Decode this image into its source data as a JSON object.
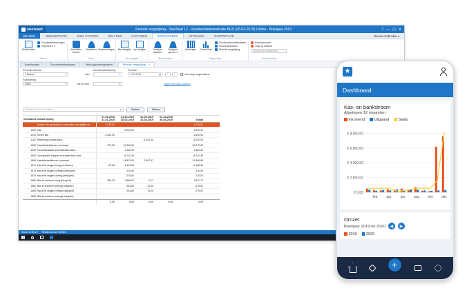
{
  "window": {
    "app_name": "snelstart",
    "title": "Periode vergelijking - SnelStart 12 - Voorbeeldadministratie BGS (05-02-2019) Online - Boekjaar 2019",
    "controls": [
      "?",
      "—",
      "▢",
      "✕"
    ]
  },
  "menu_tabs": [
    "BEHEER",
    "ADMINISTRATIE",
    "SNEL STARTEN",
    "RELATIES",
    "FACTUREN",
    "BOEKHOUDEN",
    "ARTIKELEN",
    "RAPPORTAGE"
  ],
  "active_menu_tab": "BOEKHOUDEN",
  "user_label": "Nieuwe Gebruiker ▾",
  "ribbon": {
    "groups": [
      {
        "label": "Beheer",
        "items": [
          {
            "label": "Boekhouden",
            "icon": "ledger-icon"
          }
        ],
        "small": [
          "Grootboekrekeningen",
          "Importeren ▾"
        ]
      },
      {
        "label": "Bank",
        "items": [
          {
            "label": "Afschriften inlezen",
            "icon": "download-icon"
          },
          {
            "label": "Bankieren",
            "icon": "bank-icon"
          },
          {
            "label": "Bankboekingen",
            "icon": "bank-book-icon"
          }
        ]
      },
      {
        "label": "Btw-aangifte",
        "items": [
          {
            "label": "Btw-aangifte",
            "icon": "vat-icon"
          },
          {
            "label": "Icp-aangifte",
            "icon": "icp-icon"
          }
        ]
      },
      {
        "label": "Afschrijvingen",
        "items": [
          {
            "label": "Boekjaar afsluiten",
            "icon": "close-year-icon"
          },
          {
            "label": "Boekjaar openen ▾",
            "icon": "open-year-icon"
          }
        ]
      },
      {
        "label": "Rapportage",
        "items": [
          {
            "label": "Boekingen",
            "icon": "bookings-icon"
          },
          {
            "label": "Overzichten",
            "icon": "reports-icon"
          }
        ],
        "small": [
          "Grootboekmutatiekaarten",
          "Kolommenbalans",
          "Periode vergelijking"
        ]
      },
      {
        "label": "Ondersteuning",
        "small": [
          "Klantenservice",
          "Hulp op afstand"
        ],
        "search_placeholder": "Zoeken op kenmerk/fun..."
      }
    ]
  },
  "doc_tabs": [
    "Boekhouden",
    "Grootboekrekeningen",
    "Verkoopjournaalposten",
    "Periode vergelijking"
  ],
  "active_doc_tab": "Periode vergelijking",
  "filters": {
    "periode_selectie_label": "Periode selectie",
    "periode_selectie_value": "4 Maand",
    "rubricering_label": "Rubricering",
    "rubricering_value": "Geen",
    "grootboekrekening_label": "Grootboekrekening",
    "van_label": "Van",
    "tot_label": "Tot en met",
    "periode_label": "Periode",
    "periode_value": "1-01-2019",
    "voorloop_label": "Voorloop beginbalans",
    "link_label": "Open het oude scherm",
    "search_placeholder": "Vind tekst in een te zoeken...",
    "zoeken_label": "Zoeken",
    "wissen_label": "Wissen"
  },
  "table": {
    "headers": {
      "nr": "Grootboek",
      "omschrijving": "Omschrijving",
      "periods": [
        {
          "from": "01-01-2019",
          "to": "31-01-2019"
        },
        {
          "from": "01-02-2019",
          "to": "28-02-2019"
        },
        {
          "from": "01-03-2019",
          "to": "31-03-2019"
        },
        {
          "from": "01-04-2019",
          "to": "30-04-2019"
        }
      ],
      "totaal": "Totaal"
    },
    "rows": [
      {
        "nr": "",
        "omschrijving": "Kosten van opstelling en aanvullen van afgifte en...",
        "p1": "1.276,67",
        "p2": "",
        "p3": "",
        "p4": "",
        "totaal": "1.276,67",
        "highlight": true
      },
      {
        "nr": "1000",
        "omschrijving": "Kas",
        "p1": "",
        "p2": "3.210,00",
        "p3": "",
        "p4": "",
        "totaal": "3.210,00"
      },
      {
        "nr": "1010",
        "omschrijving": "Kleine kas",
        "p1": "-1.500,00",
        "p2": "",
        "p3": "",
        "p4": "",
        "totaal": "-1.500,00"
      },
      {
        "nr": "1100",
        "omschrijving": "Rekening-courant bank",
        "p1": "",
        "p2": "",
        "p3": "-4.202,00",
        "p4": "",
        "totaal": "-4.202,00"
      },
      {
        "nr": "1300",
        "omschrijving": "Handelsdebiteuren nominaal",
        "p1": "272,25",
        "p2": "10.000,00",
        "p3": "",
        "p4": "",
        "totaal": "10.272,25"
      },
      {
        "nr": "1400",
        "omschrijving": "Vooruitbetaalde administratiekosten",
        "p1": "",
        "p2": "1.452,00",
        "p3": "",
        "p4": "",
        "totaal": "1.452,00"
      },
      {
        "nr": "1605",
        "omschrijving": "Vooraporten inkopen (exclusief btw, subt...",
        "p1": "",
        "p2": "-8.742,33",
        "p3": "",
        "p4": "",
        "totaal": "-8.742,33"
      },
      {
        "nr": "1606",
        "omschrijving": "Handelscrediteuren nominaal",
        "p1": "",
        "p2": "-14.813,00",
        "p3": "3.847,37",
        "p4": "",
        "totaal": "-10.965,63"
      },
      {
        "nr": "1671",
        "omschrijving": "btw af te dragen hoog (verkopen)",
        "p1": "-47,25",
        "p2": "-2.119,09",
        "p3": "",
        "p4": "",
        "totaal": "-2.166,34"
      },
      {
        "nr": "1674",
        "omschrijving": "btw af te dragen verlegd (verkopen)",
        "p1": "",
        "p2": "-210,00",
        "p3": "",
        "p4": "",
        "totaal": "-210,00"
      },
      {
        "nr": "1675",
        "omschrijving": "btw af te dragen overig (verkopen)",
        "p1": "",
        "p2": "210,00",
        "p3": "",
        "p4": "",
        "totaal": "210,00"
      },
      {
        "nr": "1680",
        "omschrijving": "Btw te vorderen hoog (inkopen)",
        "p1": "280,33",
        "p2": "1.566,67",
        "p3": "0,17",
        "p4": "",
        "totaal": "1.827,17"
      },
      {
        "nr": "1681",
        "omschrijving": "Btw te vorderen verlegd (inkopen)",
        "p1": "",
        "p2": "-204,82",
        "p3": "-74,20",
        "p4": "",
        "totaal": "-279,02"
      },
      {
        "nr": "1684",
        "omschrijving": "btw af te dragen verlegd (inkopen)",
        "p1": "",
        "p2": "204,82",
        "p3": "74,20",
        "p4": "",
        "totaal": "279,02"
      },
      {
        "nr": "1689",
        "omschrijving": "Btw te vorderen verlegd (inkopen)",
        "p1": "",
        "p2": "",
        "p3": "",
        "p4": "",
        "totaal": ""
      }
    ],
    "footer": {
      "p1": "0,00",
      "p2": "0,00",
      "p3": "0,00",
      "p4": "0,00",
      "totaal": "0,00"
    }
  },
  "status_bar": [
    "Versie 12.81.22",
    "Relatienummer 900301"
  ],
  "phone": {
    "header": "Dashboard",
    "card1": {
      "title": "Kas- en bankstroom",
      "subtitle": "Afgelopen 12 maanden",
      "legend": [
        {
          "name": "Inkomend",
          "color": "#e8501e"
        },
        {
          "name": "Uitgaand",
          "color": "#1f76c7"
        },
        {
          "name": "Saldo",
          "color": "#f5d23c"
        }
      ]
    },
    "card2": {
      "title": "Omzet",
      "subtitle": "Boekjaar 2019 en 2020",
      "prev_label": "◀",
      "next_label": "▶",
      "legend": [
        {
          "name": "2019",
          "color": "#e8501e"
        },
        {
          "name": "2020",
          "color": "#1f76c7"
        }
      ]
    },
    "fab_label": "+"
  },
  "chart_data": {
    "type": "bar",
    "title": "Kas- en bankstroom",
    "subtitle": "Afgelopen 12 maanden",
    "categories": [
      "jan",
      "feb",
      "mrt",
      "apr",
      "mei",
      "jun",
      "jul",
      "aug",
      "sep",
      "okt",
      "nov",
      "dec"
    ],
    "tick_labels_x": [
      "feb",
      "apr",
      "jun",
      "aug",
      "okt",
      "dec"
    ],
    "ylim": [
      0,
      9000
    ],
    "yticks": [
      {
        "value": 0,
        "label": "€ 0,00"
      },
      {
        "value": 2000,
        "label": "€ 2.000,00"
      },
      {
        "value": 4000,
        "label": "€ 4.000,00"
      },
      {
        "value": 6000,
        "label": "€ 6.000,00"
      },
      {
        "value": 8000,
        "label": "€ 8.000,00"
      }
    ],
    "grid": true,
    "legend_position": "top",
    "series": [
      {
        "name": "Inkomend",
        "type": "bar",
        "color": "#e8501e",
        "values": [
          500,
          300,
          250,
          400,
          350,
          500,
          300,
          700,
          200,
          150,
          6200,
          7600
        ]
      },
      {
        "name": "Uitgaand",
        "type": "bar",
        "color": "#1f76c7",
        "values": [
          350,
          200,
          300,
          250,
          400,
          300,
          450,
          350,
          250,
          200,
          250,
          300
        ]
      },
      {
        "name": "Saldo",
        "type": "line",
        "color": "#f5d23c",
        "values": [
          550,
          550,
          550,
          550,
          200,
          200,
          350,
          550,
          550,
          550,
          1600,
          8200
        ]
      }
    ]
  }
}
